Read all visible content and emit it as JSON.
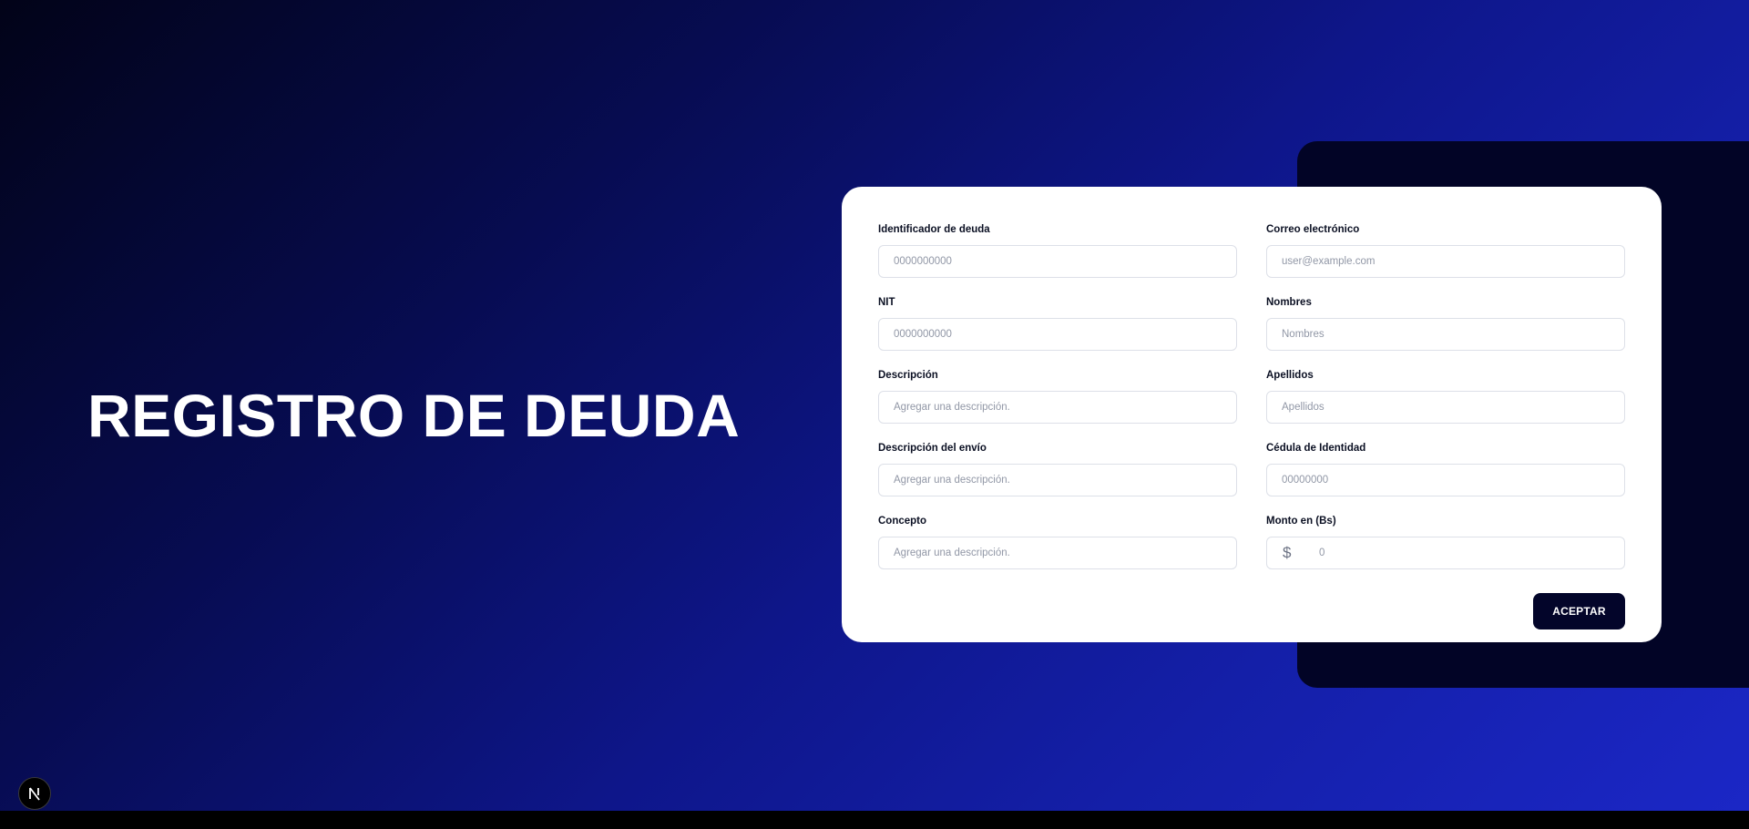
{
  "page": {
    "title": "REGISTRO DE DEUDA"
  },
  "form": {
    "left": [
      {
        "label": "Identificador de deuda",
        "placeholder": "0000000000"
      },
      {
        "label": "NIT",
        "placeholder": "0000000000"
      },
      {
        "label": "Descripción",
        "placeholder": "Agregar una descripción."
      },
      {
        "label": "Descripción del envío",
        "placeholder": "Agregar una descripción."
      },
      {
        "label": "Concepto",
        "placeholder": "Agregar una descripción."
      }
    ],
    "right": [
      {
        "label": "Correo electrónico",
        "placeholder": "user@example.com"
      },
      {
        "label": "Nombres",
        "placeholder": "Nombres"
      },
      {
        "label": "Apellidos",
        "placeholder": "Apellidos"
      },
      {
        "label": "Cédula de Identidad",
        "placeholder": "00000000"
      },
      {
        "label": "Monto en (Bs)",
        "placeholder": "0",
        "prefix": "$"
      }
    ],
    "submit_label": "ACEPTAR"
  },
  "badge": {
    "icon": "nextjs-n-icon"
  },
  "colors": {
    "background_start": "#020318",
    "background_end": "#1b27c6",
    "panel": "#020426",
    "button": "#03052a"
  }
}
